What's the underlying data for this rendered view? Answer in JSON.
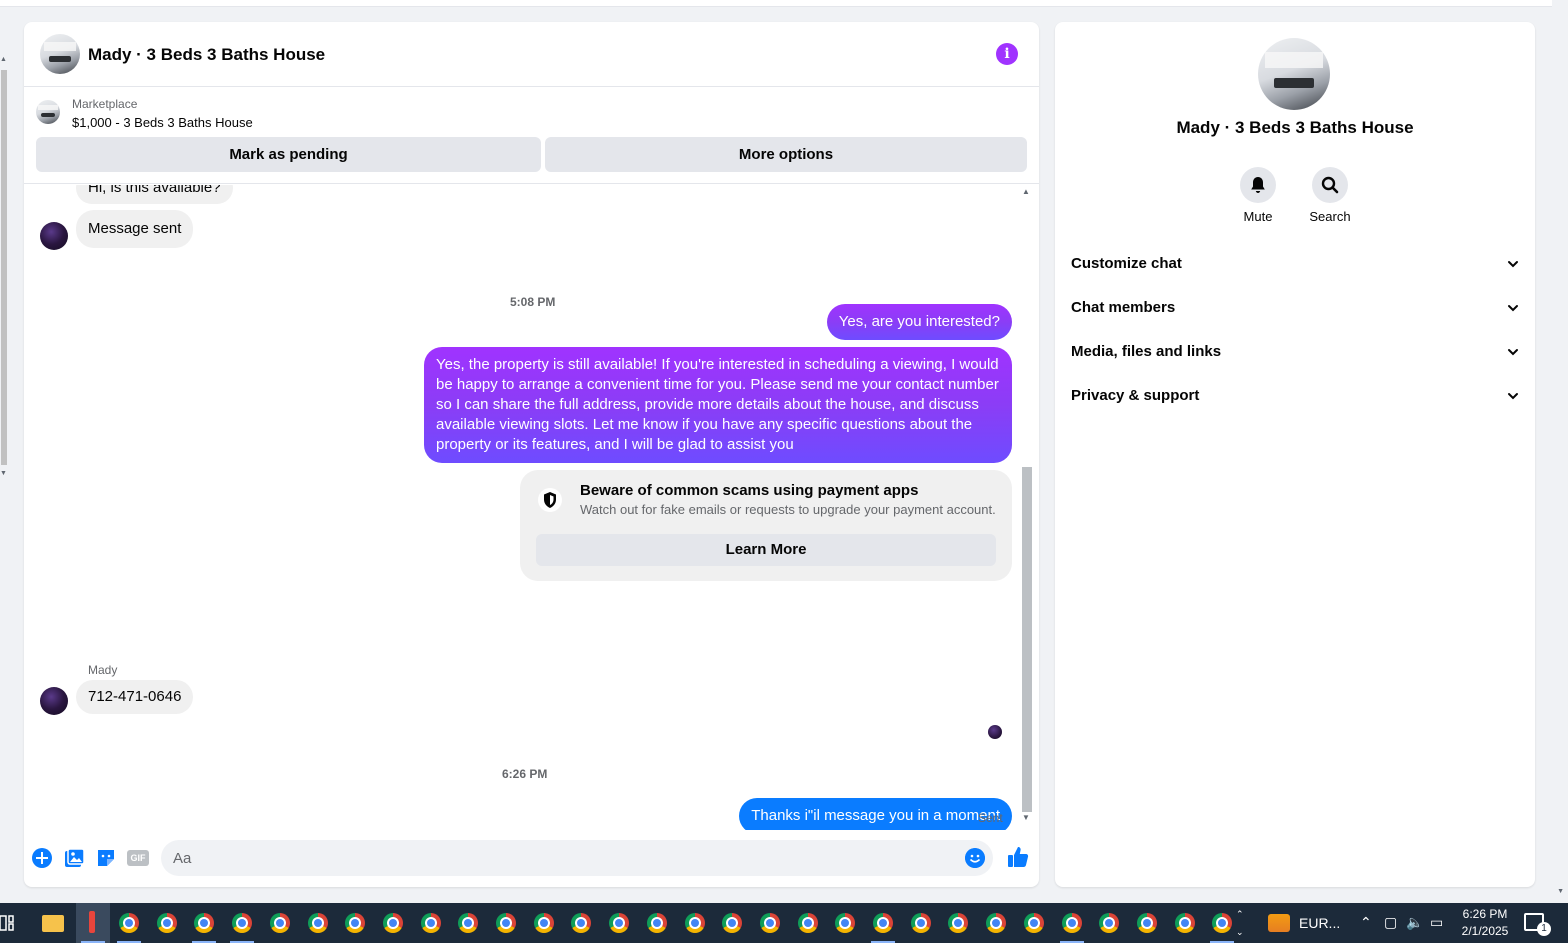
{
  "chat": {
    "title": "Mady · 3 Beds 3 Baths House",
    "info_icon": "i",
    "marketplace_label": "Marketplace",
    "listing": "$1,000 - 3 Beds 3 Baths House",
    "mark_pending": "Mark as pending",
    "more_options": "More options"
  },
  "messages": {
    "in_partial": "Hi, is this available?",
    "in_sent": "Message sent",
    "time1": "5:08 PM",
    "out1": "Yes, are you interested?",
    "out2": "Yes, the property is still available! If you're interested in scheduling a viewing, I would be happy to arrange a convenient time for you. Please send me your contact number so I can share the full address, provide more details about the house, and discuss available viewing slots. Let me know if you have any specific questions about the property or its features, and I will be glad to assist you",
    "sender_name": "Mady",
    "in_phone": "712-471-0646",
    "time2": "6:26 PM",
    "out3": "Thanks i\"il message you in a moment",
    "status": "Sent"
  },
  "scam": {
    "title": "Beware of common scams using payment apps",
    "text": "Watch out for fake emails or requests to upgrade your payment account.",
    "button": "Learn More"
  },
  "composer": {
    "placeholder": "Aa",
    "gif_label": "GIF"
  },
  "info_panel": {
    "title": "Mady · 3 Beds 3 Baths House",
    "mute": "Mute",
    "search": "Search",
    "sections": [
      "Customize chat",
      "Chat members",
      "Media, files and links",
      "Privacy & support"
    ]
  },
  "taskbar": {
    "eur_label": "EUR...",
    "time": "6:26 PM",
    "date": "2/1/2025",
    "notification_count": "1"
  },
  "colors": {
    "accent": "#a033ff",
    "bubble_gradient_end": "#6e4cff",
    "messenger_blue": "#0a7cff"
  },
  "icons": [
    "info-icon",
    "shield-icon",
    "add-icon",
    "photo-icon",
    "sticker-icon",
    "gif-icon",
    "emoji-icon",
    "like-icon",
    "bell-icon",
    "search-icon",
    "chevron-down-icon"
  ]
}
